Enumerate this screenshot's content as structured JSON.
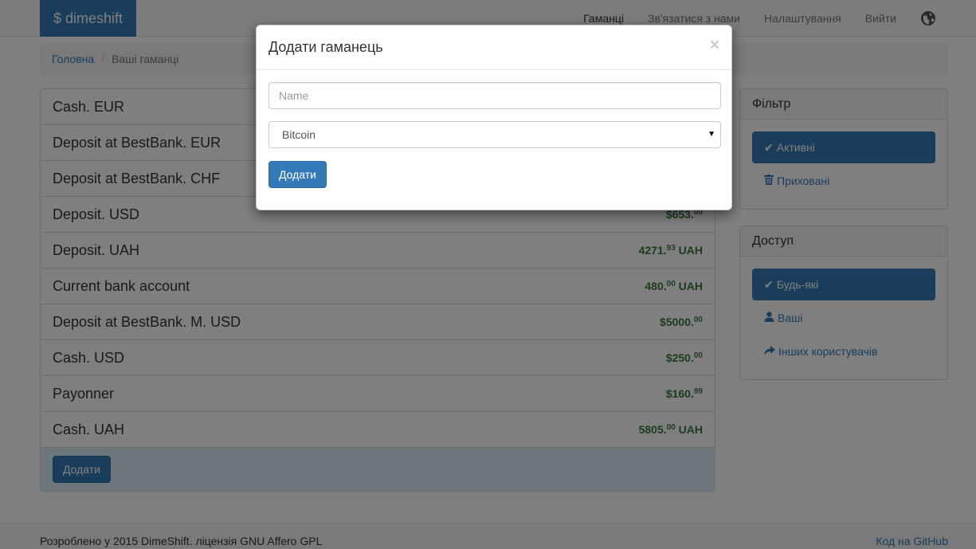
{
  "navbar": {
    "brand": "$ dimeshift",
    "links": [
      "Гаманці",
      "Зв'язатися з нами",
      "Налаштування",
      "Вийти"
    ],
    "language_icon": "globe-icon"
  },
  "breadcrumb": {
    "home": "Головна",
    "current": "Ваші гаманці"
  },
  "wallets": [
    {
      "name": "Cash. EUR",
      "amount_main": "",
      "amount_cents": "",
      "amount_suffix": ""
    },
    {
      "name": "Deposit at BestBank. EUR",
      "amount_main": "",
      "amount_cents": "",
      "amount_suffix": ""
    },
    {
      "name": "Deposit at BestBank. CHF",
      "amount_main": "",
      "amount_cents": "",
      "amount_suffix": ""
    },
    {
      "name": "Deposit. USD",
      "amount_main": "$653.",
      "amount_cents": "00",
      "amount_suffix": ""
    },
    {
      "name": "Deposit. UAH",
      "amount_main": "4271.",
      "amount_cents": "93",
      "amount_suffix": " UAH"
    },
    {
      "name": "Current bank account",
      "amount_main": "480.",
      "amount_cents": "00",
      "amount_suffix": " UAH"
    },
    {
      "name": "Deposit at BestBank. M. USD",
      "amount_main": "$5000.",
      "amount_cents": "00",
      "amount_suffix": ""
    },
    {
      "name": "Cash. USD",
      "amount_main": "$250.",
      "amount_cents": "00",
      "amount_suffix": ""
    },
    {
      "name": "Payonner",
      "amount_main": "$160.",
      "amount_cents": "99",
      "amount_suffix": ""
    },
    {
      "name": "Cash. UAH",
      "amount_main": "5805.",
      "amount_cents": "00",
      "amount_suffix": " UAH"
    }
  ],
  "wallets_footer": {
    "add_label": "Додати"
  },
  "filter_panel": {
    "title": "Фільтр",
    "items": [
      {
        "label": "Активні",
        "icon": "check-icon",
        "active": true
      },
      {
        "label": "Приховані",
        "icon": "trash-icon",
        "active": false
      }
    ]
  },
  "access_panel": {
    "title": "Доступ",
    "items": [
      {
        "label": "Будь-які",
        "icon": "check-icon",
        "active": true
      },
      {
        "label": "Ваші",
        "icon": "user-icon",
        "active": false
      },
      {
        "label": "Інших користувачів",
        "icon": "share-icon",
        "active": false
      }
    ]
  },
  "footer": {
    "left": "Розроблено у 2015 DimeShift. ліцензія GNU Affero GPL",
    "right": "Код на GitHub"
  },
  "modal": {
    "title": "Додати гаманець",
    "close": "×",
    "name_placeholder": "Name",
    "currency_selected": "Bitcoin",
    "submit_label": "Додати"
  },
  "colors": {
    "primary": "#337ab7",
    "amount_green": "#3c763d",
    "footer_bar": "#d9edf7"
  }
}
